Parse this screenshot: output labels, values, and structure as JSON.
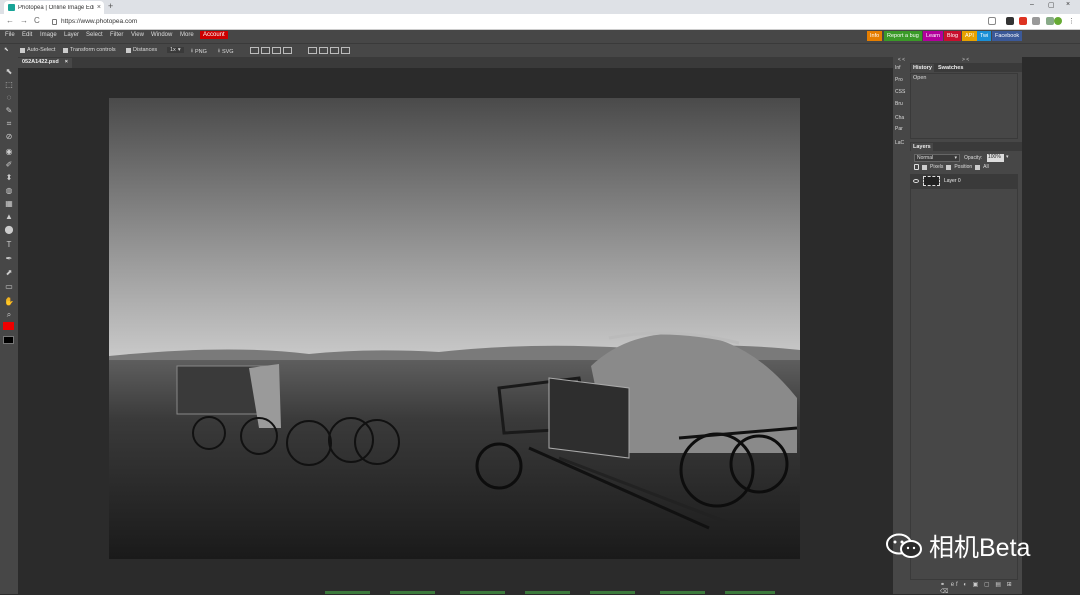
{
  "browser": {
    "tab_title": "Photopea | Online Image Edit",
    "tab_close": "×",
    "new_tab": "+",
    "url": "https://www.photopea.com",
    "win_min": "–",
    "win_max": "▢",
    "win_close": "×",
    "back": "←",
    "forward": "→",
    "reload": "C"
  },
  "menu": {
    "items": [
      "File",
      "Edit",
      "Image",
      "Layer",
      "Select",
      "Filter",
      "View",
      "Window",
      "More"
    ],
    "account": "Account",
    "badges": [
      {
        "label": "Info",
        "color": "#e67e00"
      },
      {
        "label": "Report a bug",
        "color": "#3a9a28"
      },
      {
        "label": "Learn",
        "color": "#b3009c"
      },
      {
        "label": "Blog",
        "color": "#c8102e"
      },
      {
        "label": "API",
        "color": "#e6a200"
      },
      {
        "label": "Twi",
        "color": "#1a8fd6"
      },
      {
        "label": "Facebook",
        "color": "#3b5998"
      }
    ]
  },
  "options": {
    "auto_select": "Auto-Select",
    "transform_controls": "Transform controls",
    "distances": "Distances",
    "zoom": "1x",
    "png": "PNG",
    "svg": "SVG"
  },
  "document": {
    "tab": "052A1422.psd",
    "close": "×"
  },
  "tools": [
    "⬉",
    "⬚",
    "◌",
    "✎",
    "⌗",
    "⊘",
    "◉",
    "✐",
    "⬍",
    "◍",
    "▦",
    "▲",
    "⬤",
    "T",
    "✒",
    "⬈",
    "▭",
    "✋",
    "⌕"
  ],
  "midcol": {
    "arrow": "< <",
    "items": [
      "Inf",
      "Pro",
      "CSS",
      "Bru",
      "Cha",
      "Par",
      "LaC"
    ]
  },
  "panels": {
    "arrow": "> <",
    "history_tab": "History",
    "swatches_tab": "Swatches",
    "history_items": [
      "Open"
    ],
    "layers_tab": "Layers",
    "blend_mode": "Normal",
    "opacity_label": "Opacity:",
    "opacity_value": "100%",
    "lock_pixels": "Pixels",
    "lock_position": "Position",
    "lock_all": "All",
    "layer_name": "Layer 0",
    "footer_icons": "⚭ ef ◐ ▣ ▢ ▤ ⊞ ⌫"
  },
  "watermark": {
    "text": "相机Beta"
  },
  "colors": {
    "foreground": "#ee0000",
    "background": "#000000",
    "panel": "#474747"
  }
}
